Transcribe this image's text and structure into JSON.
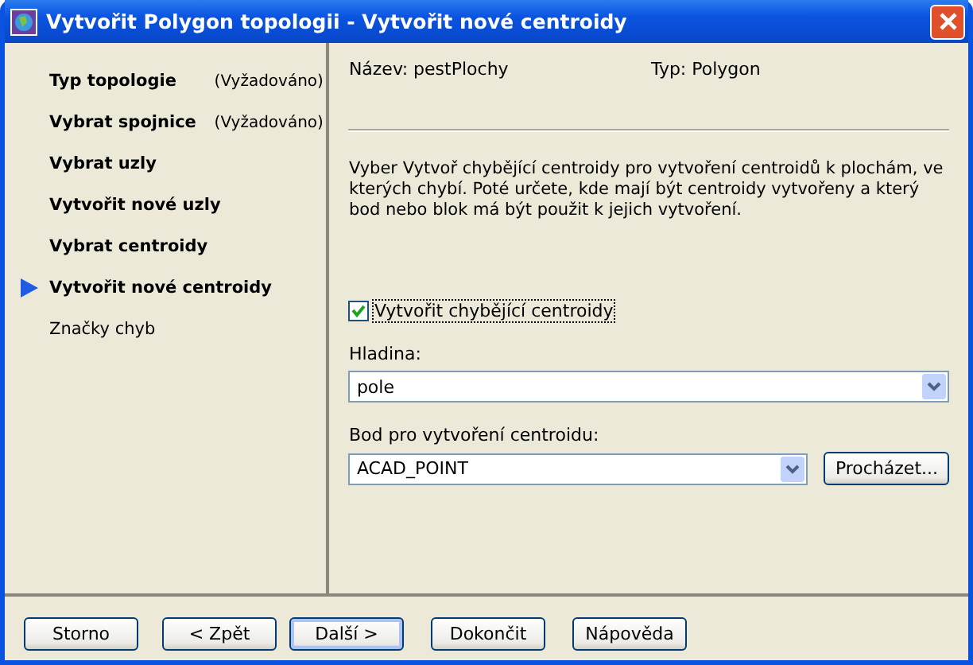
{
  "window": {
    "title": "Vytvořit Polygon topologii - Vytvořit nové centroidy"
  },
  "steps": [
    {
      "label": "Typ topologie",
      "note": "(Vyžadováno)",
      "available": true,
      "selected": false
    },
    {
      "label": "Vybrat spojnice",
      "note": "(Vyžadováno)",
      "available": true,
      "selected": false
    },
    {
      "label": "Vybrat uzly",
      "available": true,
      "selected": false
    },
    {
      "label": "Vytvořit nové uzly",
      "available": true,
      "selected": false
    },
    {
      "label": "Vybrat centroidy",
      "available": true,
      "selected": false
    },
    {
      "label": "Vytvořit nové centroidy",
      "available": true,
      "selected": true
    },
    {
      "label": "Značky chyb",
      "available": false,
      "selected": false
    }
  ],
  "info": {
    "name": "Název: pestPlochy",
    "type": "Typ: Polygon"
  },
  "description": "Vyber Vytvoř chybějící centroidy pro vytvoření centroidů k plochám, ve kterých chybí. Poté určete, kde mají být centroidy vytvořeny a který bod nebo blok má být použit k jejich vytvoření.",
  "checkbox": {
    "label": "Vytvořit chybějící centroidy",
    "checked": true
  },
  "layer": {
    "label": "Hladina:",
    "value": "pole"
  },
  "point": {
    "label": "Bod pro vytvoření centroidu:",
    "value": "ACAD_POINT",
    "browse": "Procházet..."
  },
  "buttons": [
    {
      "label": "Storno",
      "default": false
    },
    {
      "label": "< Zpět",
      "default": false
    },
    {
      "label": "Další >",
      "default": true
    },
    {
      "label": "Dokončit",
      "default": false
    },
    {
      "label": "Nápověda",
      "default": false
    }
  ]
}
